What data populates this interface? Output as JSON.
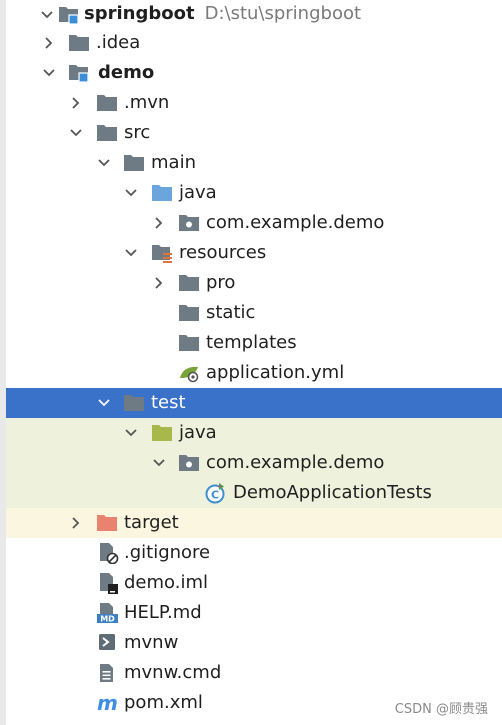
{
  "project_tree": {
    "root": {
      "name": "springboot",
      "path": "D:\\stu\\springboot"
    },
    "idea": ".idea",
    "demo": "demo",
    "mvn": ".mvn",
    "src": "src",
    "main": "main",
    "main_java": "java",
    "main_package": "com.example.demo",
    "resources": "resources",
    "pro": "pro",
    "static": "static",
    "templates": "templates",
    "application_yml": "application.yml",
    "test": "test",
    "test_java": "java",
    "test_package": "com.example.demo",
    "test_class": "DemoApplicationTests",
    "target": "target",
    "gitignore": ".gitignore",
    "demo_iml": "demo.iml",
    "help_md": "HELP.md",
    "mvnw": "mvnw",
    "mvnw_cmd": "mvnw.cmd",
    "pom_xml": "pom.xml"
  },
  "icon_badges": {
    "md": "MD",
    "class": "C"
  },
  "watermark": "CSDN @顾贵强",
  "colors": {
    "selection": "#3a71c9",
    "folder_gray": "#6e7a84",
    "folder_blue": "#6aa6dc",
    "folder_green": "#a8b84a",
    "folder_excluded": "#e9836f",
    "module_square": "#3b8fd9"
  }
}
